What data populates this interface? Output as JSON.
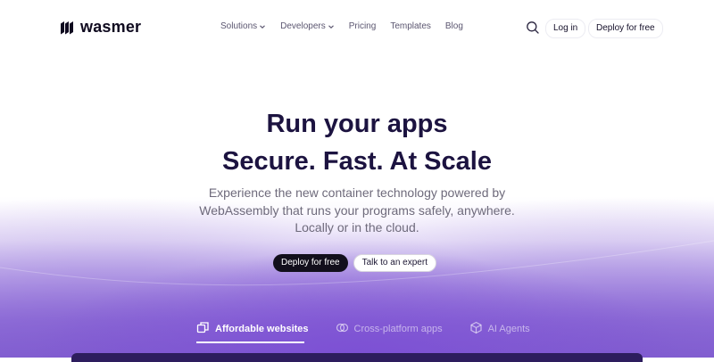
{
  "brand": {
    "name": "wasmer"
  },
  "nav": {
    "links": [
      {
        "label": "Solutions",
        "has_caret": true
      },
      {
        "label": "Developers",
        "has_caret": true
      },
      {
        "label": "Pricing",
        "has_caret": false
      },
      {
        "label": "Templates",
        "has_caret": false
      },
      {
        "label": "Blog",
        "has_caret": false
      }
    ],
    "search_icon": "search-icon",
    "login_label": "Log in",
    "deploy_label": "Deploy for free"
  },
  "hero": {
    "title_line1": "Run your apps",
    "title_line2": "Secure. Fast. At Scale",
    "subtitle_line1": "Experience the new container technology powered by",
    "subtitle_line2": "WebAssembly that runs your programs safely, anywhere.",
    "subtitle_line3": "Locally or in the cloud.",
    "cta_primary": "Deploy for free",
    "cta_secondary": "Talk to an expert"
  },
  "tabs": [
    {
      "label": "Affordable websites",
      "icon": "copy-icon",
      "active": true
    },
    {
      "label": "Cross-platform apps",
      "icon": "overlap-circles-icon",
      "active": false
    },
    {
      "label": "AI Agents",
      "icon": "cube-icon",
      "active": false
    }
  ],
  "colors": {
    "title": "#1c1340",
    "subtitle": "#6e6a7b",
    "primary_button": "#120f1c",
    "gradient_purple": "#8464d3"
  }
}
